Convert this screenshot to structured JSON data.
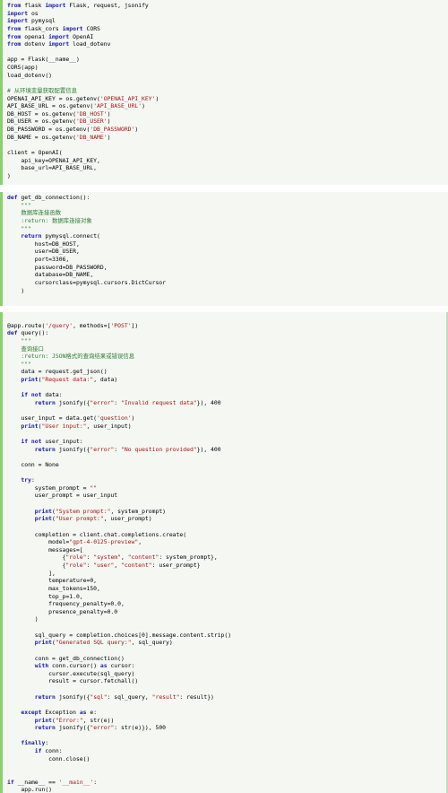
{
  "editor": {
    "background": "#f4f7f2",
    "gutter_accent": "#8ccf6e",
    "language": "python"
  },
  "segments": [
    {
      "name": "imports-and-config",
      "lines": [
        [
          [
            "k",
            "from"
          ],
          [
            "p",
            " flask "
          ],
          [
            "k",
            "import"
          ],
          [
            "p",
            " Flask, request, jsonify"
          ]
        ],
        [
          [
            "k",
            "import"
          ],
          [
            "p",
            " os"
          ]
        ],
        [
          [
            "k",
            "import"
          ],
          [
            "p",
            " pymysql"
          ]
        ],
        [
          [
            "k",
            "from"
          ],
          [
            "p",
            " flask_cors "
          ],
          [
            "k",
            "import"
          ],
          [
            "p",
            " CORS"
          ]
        ],
        [
          [
            "k",
            "from"
          ],
          [
            "p",
            " openai "
          ],
          [
            "k",
            "import"
          ],
          [
            "p",
            " OpenAI"
          ]
        ],
        [
          [
            "k",
            "from"
          ],
          [
            "p",
            " dotenv "
          ],
          [
            "k",
            "import"
          ],
          [
            "p",
            " load_dotenv"
          ]
        ],
        [],
        [
          [
            "p",
            "app = Flask(__name__)"
          ]
        ],
        [
          [
            "p",
            "CORS(app)"
          ]
        ],
        [
          [
            "p",
            "load_dotenv()"
          ]
        ],
        [],
        [
          [
            "c",
            "# 从环境变量获取配置信息"
          ]
        ],
        [
          [
            "p",
            "OPENAI_API_KEY = os.getenv("
          ],
          [
            "s",
            "'OPENAI_API_KEY'"
          ],
          [
            "p",
            ")"
          ]
        ],
        [
          [
            "p",
            "API_BASE_URL = os.getenv("
          ],
          [
            "s",
            "'API_BASE_URL'"
          ],
          [
            "p",
            ")"
          ]
        ],
        [
          [
            "p",
            "DB_HOST = os.getenv("
          ],
          [
            "s",
            "'DB_HOST'"
          ],
          [
            "p",
            ")"
          ]
        ],
        [
          [
            "p",
            "DB_USER = os.getenv("
          ],
          [
            "s",
            "'DB_USER'"
          ],
          [
            "p",
            ")"
          ]
        ],
        [
          [
            "p",
            "DB_PASSWORD = os.getenv("
          ],
          [
            "s",
            "'DB_PASSWORD'"
          ],
          [
            "p",
            ")"
          ]
        ],
        [
          [
            "p",
            "DB_NAME = os.getenv("
          ],
          [
            "s",
            "'DB_NAME'"
          ],
          [
            "p",
            ")"
          ]
        ],
        [],
        [
          [
            "p",
            "client = OpenAI("
          ]
        ],
        [
          [
            "p",
            "    api_key=OPENAI_API_KEY,"
          ]
        ],
        [
          [
            "p",
            "    base_url=API_BASE_URL,"
          ]
        ],
        [
          [
            "p",
            ")"
          ]
        ]
      ]
    },
    {
      "name": "get-db-connection",
      "lines": [
        [
          [
            "k",
            "def"
          ],
          [
            "p",
            " get_db_connection():"
          ]
        ],
        [
          [
            "c",
            "    \"\"\""
          ]
        ],
        [
          [
            "c",
            "    数据库连接函数"
          ]
        ],
        [
          [
            "c",
            "    :return: 数据库连接对象"
          ]
        ],
        [
          [
            "c",
            "    \"\"\""
          ]
        ],
        [
          [
            "p",
            "    "
          ],
          [
            "k",
            "return"
          ],
          [
            "p",
            " pymysql.connect("
          ]
        ],
        [
          [
            "p",
            "        host=DB_HOST,"
          ]
        ],
        [
          [
            "p",
            "        user=DB_USER,"
          ]
        ],
        [
          [
            "p",
            "        port=3306,"
          ]
        ],
        [
          [
            "p",
            "        password=DB_PASSWORD,"
          ]
        ],
        [
          [
            "p",
            "        database=DB_NAME,"
          ]
        ],
        [
          [
            "p",
            "        cursorclass=pymysql.cursors.DictCursor"
          ]
        ],
        [
          [
            "p",
            "    )"
          ]
        ]
      ]
    },
    {
      "name": "query-route",
      "lines": [
        [],
        [
          [
            "p",
            "@app.route("
          ],
          [
            "s",
            "'/query'"
          ],
          [
            "p",
            ", methods=["
          ],
          [
            "s",
            "'POST'"
          ],
          [
            "p",
            "])"
          ]
        ],
        [
          [
            "k",
            "def"
          ],
          [
            "p",
            " query():"
          ]
        ],
        [
          [
            "c",
            "    \"\"\""
          ]
        ],
        [
          [
            "c",
            "    查询接口"
          ]
        ],
        [
          [
            "c",
            "    :return: JSON格式的查询结果或错误信息"
          ]
        ],
        [
          [
            "c",
            "    \"\"\""
          ]
        ],
        [
          [
            "p",
            "    data = request.get_json()"
          ]
        ],
        [
          [
            "p",
            "    "
          ],
          [
            "k",
            "print"
          ],
          [
            "p",
            "("
          ],
          [
            "s",
            "\"Request data:\""
          ],
          [
            "p",
            ", data)"
          ]
        ],
        [],
        [
          [
            "p",
            "    "
          ],
          [
            "k",
            "if not"
          ],
          [
            "p",
            " data:"
          ]
        ],
        [
          [
            "p",
            "        "
          ],
          [
            "k",
            "return"
          ],
          [
            "p",
            " jsonify({"
          ],
          [
            "s",
            "\"error\""
          ],
          [
            "p",
            ": "
          ],
          [
            "s",
            "\"Invalid request data\""
          ],
          [
            "p",
            "}), 400"
          ]
        ],
        [],
        [
          [
            "p",
            "    user_input = data.get("
          ],
          [
            "s",
            "'question'"
          ],
          [
            "p",
            ")"
          ]
        ],
        [
          [
            "p",
            "    "
          ],
          [
            "k",
            "print"
          ],
          [
            "p",
            "("
          ],
          [
            "s",
            "\"User input:\""
          ],
          [
            "p",
            ", user_input)"
          ]
        ],
        [],
        [
          [
            "p",
            "    "
          ],
          [
            "k",
            "if not"
          ],
          [
            "p",
            " user_input:"
          ]
        ],
        [
          [
            "p",
            "        "
          ],
          [
            "k",
            "return"
          ],
          [
            "p",
            " jsonify({"
          ],
          [
            "s",
            "\"error\""
          ],
          [
            "p",
            ": "
          ],
          [
            "s",
            "\"No question provided\""
          ],
          [
            "p",
            "}), 400"
          ]
        ],
        [],
        [
          [
            "p",
            "    conn = None"
          ]
        ],
        [],
        [
          [
            "p",
            "    "
          ],
          [
            "k",
            "try"
          ],
          [
            "p",
            ":"
          ]
        ],
        [
          [
            "p",
            "        system_prompt = "
          ],
          [
            "s",
            "\"\""
          ]
        ],
        [
          [
            "p",
            "        user_prompt = user_input"
          ]
        ],
        [],
        [
          [
            "p",
            "        "
          ],
          [
            "k",
            "print"
          ],
          [
            "p",
            "("
          ],
          [
            "s",
            "\"System prompt:\""
          ],
          [
            "p",
            ", system_prompt)"
          ]
        ],
        [
          [
            "p",
            "        "
          ],
          [
            "k",
            "print"
          ],
          [
            "p",
            "("
          ],
          [
            "s",
            "\"User prompt:\""
          ],
          [
            "p",
            ", user_prompt)"
          ]
        ],
        [],
        [
          [
            "p",
            "        completion = client.chat.completions.create("
          ]
        ],
        [
          [
            "p",
            "            model="
          ],
          [
            "s",
            "\"gpt-4-0125-preview\""
          ],
          [
            "p",
            ","
          ]
        ],
        [
          [
            "p",
            "            messages=["
          ]
        ],
        [
          [
            "p",
            "                {"
          ],
          [
            "s",
            "\"role\""
          ],
          [
            "p",
            ": "
          ],
          [
            "s",
            "\"system\""
          ],
          [
            "p",
            ", "
          ],
          [
            "s",
            "\"content\""
          ],
          [
            "p",
            ": system_prompt},"
          ]
        ],
        [
          [
            "p",
            "                {"
          ],
          [
            "s",
            "\"role\""
          ],
          [
            "p",
            ": "
          ],
          [
            "s",
            "\"user\""
          ],
          [
            "p",
            ", "
          ],
          [
            "s",
            "\"content\""
          ],
          [
            "p",
            ": user_prompt}"
          ]
        ],
        [
          [
            "p",
            "            ],"
          ]
        ],
        [
          [
            "p",
            "            temperature=0,"
          ]
        ],
        [
          [
            "p",
            "            max_tokens=150,"
          ]
        ],
        [
          [
            "p",
            "            top_p=1.0,"
          ]
        ],
        [
          [
            "p",
            "            frequency_penalty=0.0,"
          ]
        ],
        [
          [
            "p",
            "            presence_penalty=0.0"
          ]
        ],
        [
          [
            "p",
            "        )"
          ]
        ],
        [],
        [
          [
            "p",
            "        sql_query = completion.choices[0].message.content.strip()"
          ]
        ],
        [
          [
            "p",
            "        "
          ],
          [
            "k",
            "print"
          ],
          [
            "p",
            "("
          ],
          [
            "s",
            "\"Generated SQL query:\""
          ],
          [
            "p",
            ", sql_query)"
          ]
        ],
        [],
        [
          [
            "p",
            "        conn = get_db_connection()"
          ]
        ],
        [
          [
            "p",
            "        "
          ],
          [
            "k",
            "with"
          ],
          [
            "p",
            " conn.cursor() "
          ],
          [
            "k",
            "as"
          ],
          [
            "p",
            " cursor:"
          ]
        ],
        [
          [
            "p",
            "            cursor.execute(sql_query)"
          ]
        ],
        [
          [
            "p",
            "            result = cursor.fetchall()"
          ]
        ],
        [],
        [
          [
            "p",
            "        "
          ],
          [
            "k",
            "return"
          ],
          [
            "p",
            " jsonify({"
          ],
          [
            "s",
            "\"sql\""
          ],
          [
            "p",
            ": sql_query, "
          ],
          [
            "s",
            "\"result\""
          ],
          [
            "p",
            ": result})"
          ]
        ],
        [],
        [
          [
            "p",
            "    "
          ],
          [
            "k",
            "except"
          ],
          [
            "p",
            " Exception "
          ],
          [
            "k",
            "as"
          ],
          [
            "p",
            " e:"
          ]
        ],
        [
          [
            "p",
            "        "
          ],
          [
            "k",
            "print"
          ],
          [
            "p",
            "("
          ],
          [
            "s",
            "\"Error:\""
          ],
          [
            "p",
            ", str(e))"
          ]
        ],
        [
          [
            "p",
            "        "
          ],
          [
            "k",
            "return"
          ],
          [
            "p",
            " jsonify({"
          ],
          [
            "s",
            "\"error\""
          ],
          [
            "p",
            ": str(e)}), 500"
          ]
        ],
        [],
        [
          [
            "p",
            "    "
          ],
          [
            "k",
            "finally"
          ],
          [
            "p",
            ":"
          ]
        ],
        [
          [
            "p",
            "        "
          ],
          [
            "k",
            "if"
          ],
          [
            "p",
            " conn:"
          ]
        ],
        [
          [
            "p",
            "            conn.close()"
          ]
        ],
        [],
        [],
        [
          [
            "k",
            "if"
          ],
          [
            "p",
            " __name__ == "
          ],
          [
            "s",
            "'__main__'"
          ],
          [
            "p",
            ":"
          ]
        ],
        [
          [
            "p",
            "    app.run()"
          ]
        ]
      ]
    }
  ]
}
